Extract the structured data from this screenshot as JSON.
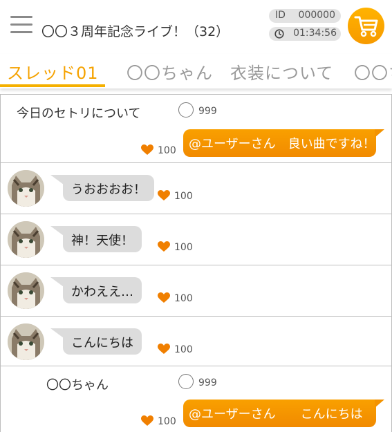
{
  "header": {
    "title": "〇〇３周年記念ライブ！（32）",
    "id_label": "ID",
    "id_value": "000000",
    "timer": "01:34:56",
    "menu_icon": "hamburger-menu-icon",
    "clock_icon": "clock-icon",
    "cart_icon": "shopping-cart-icon"
  },
  "tabs": [
    {
      "label": "スレッド01",
      "active": true
    },
    {
      "label": "〇〇ちゃん",
      "active": false
    },
    {
      "label": "衣装について",
      "active": false
    },
    {
      "label": "〇〇ち",
      "active": false
    }
  ],
  "threads": [
    {
      "title": "今日のセトリについて",
      "reply_count": "999",
      "like_count": "100",
      "comment": "@ユーザーさん　良い曲ですね！"
    },
    {
      "title": "〇〇ちゃん",
      "reply_count": "999",
      "like_count": "100",
      "comment": "@ユーザーさん　　こんにちは"
    }
  ],
  "messages": [
    {
      "text": "うおおおお！",
      "like_count": "100"
    },
    {
      "text": "神！天使！",
      "like_count": "100"
    },
    {
      "text": "かわええ…",
      "like_count": "100"
    },
    {
      "text": "こんにちは",
      "like_count": "100"
    }
  ],
  "colors": {
    "accent": "#f5a200",
    "heart": "#f07f00",
    "bubble_gray": "#dcdcdc",
    "cart_bg": "#ffb300"
  }
}
